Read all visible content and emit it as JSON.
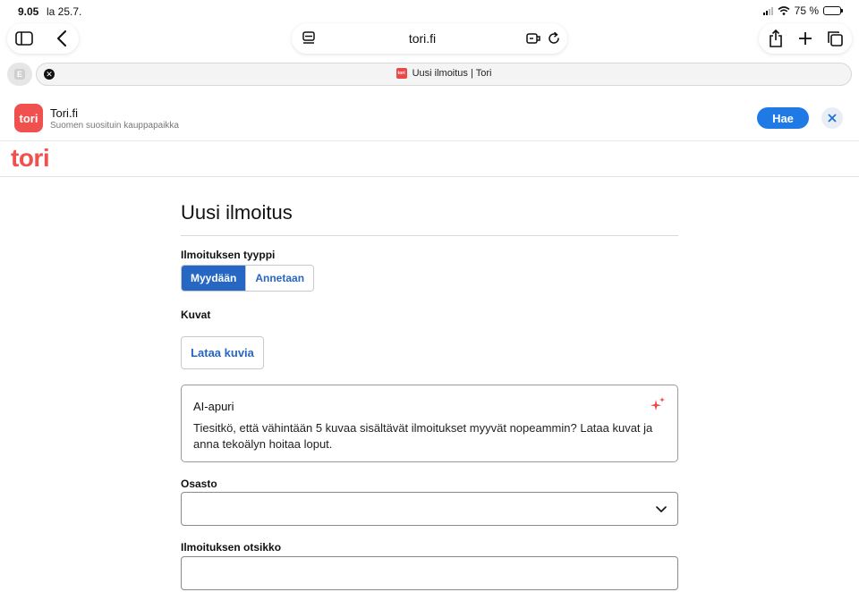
{
  "status_bar": {
    "time": "9.05",
    "date": "la 25.7.",
    "battery_text": "75 %",
    "battery_level": 0.75
  },
  "browser": {
    "url": "tori.fi",
    "tab_title": "Uusi ilmoitus | Tori",
    "favicon_text": "tori"
  },
  "smart_banner": {
    "app_icon_text": "tori",
    "app_name": "Tori.fi",
    "app_subtitle": "Suomen suosituin kauppapaikka",
    "action_label": "Hae"
  },
  "site": {
    "logo": "tori",
    "brand_color": "#f0514f"
  },
  "form": {
    "page_title": "Uusi ilmoitus",
    "type_label": "Ilmoituksen tyyppi",
    "type_options": [
      "Myydään",
      "Annetaan"
    ],
    "type_selected": "Myydään",
    "images_label": "Kuvat",
    "upload_label": "Lataa kuvia",
    "ai_title": "AI-apuri",
    "ai_text": "Tiesitkö, että vähintään 5 kuvaa sisältävät ilmoitukset myyvät nopeammin? Lataa kuvat ja anna tekoälyn hoitaa loput.",
    "department_label": "Osasto",
    "department_value": "",
    "title_label": "Ilmoituksen otsikko",
    "title_value": "",
    "accent_color": "#2767c4"
  }
}
